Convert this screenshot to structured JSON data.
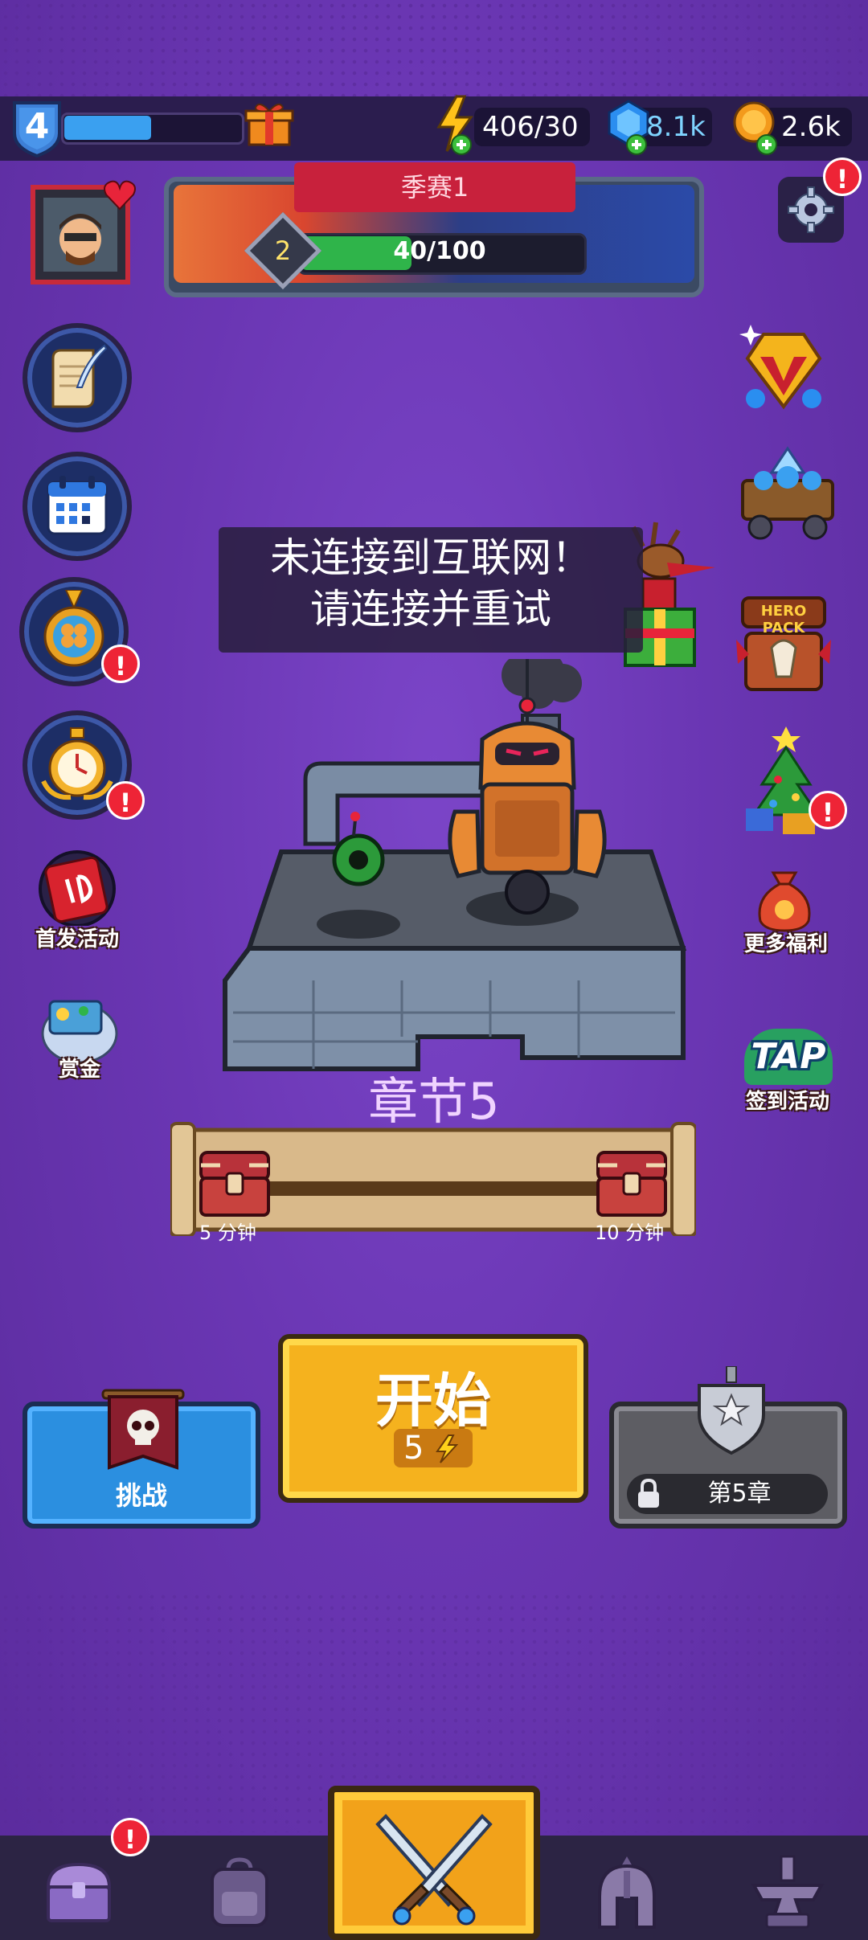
{
  "top_bar": {
    "player_level": "4",
    "energy": "406/30",
    "gems": "8.1k",
    "coins": "2.6k"
  },
  "season": {
    "title": "季赛1",
    "level": "2",
    "progress_text": "40/100",
    "progress": 0.4
  },
  "toast": {
    "line1": "未连接到互联网！",
    "line2": "请连接并重试"
  },
  "left_menu": {
    "first_launch_label": "首发活动",
    "bounty_label": "赏金"
  },
  "right_menu": {
    "hero_pack_label": "HERO PACK",
    "more_benefits_label": "更多福利",
    "tap_label": "TAP",
    "checkin_label": "签到活动"
  },
  "chapter": {
    "title": "章节5",
    "chest1_time": "5 分钟",
    "chest2_time": "10 分钟"
  },
  "buttons": {
    "challenge": "挑战",
    "start": "开始",
    "start_cost": "5",
    "chapter_lock": "第5章"
  },
  "badges": {
    "alert": "!"
  },
  "colors": {
    "background": "#6b3bb4",
    "accent_yellow": "#f5b21e",
    "alert_red": "#ee2436",
    "xp_blue": "#3aa0f0",
    "season_green": "#2fb44a"
  }
}
